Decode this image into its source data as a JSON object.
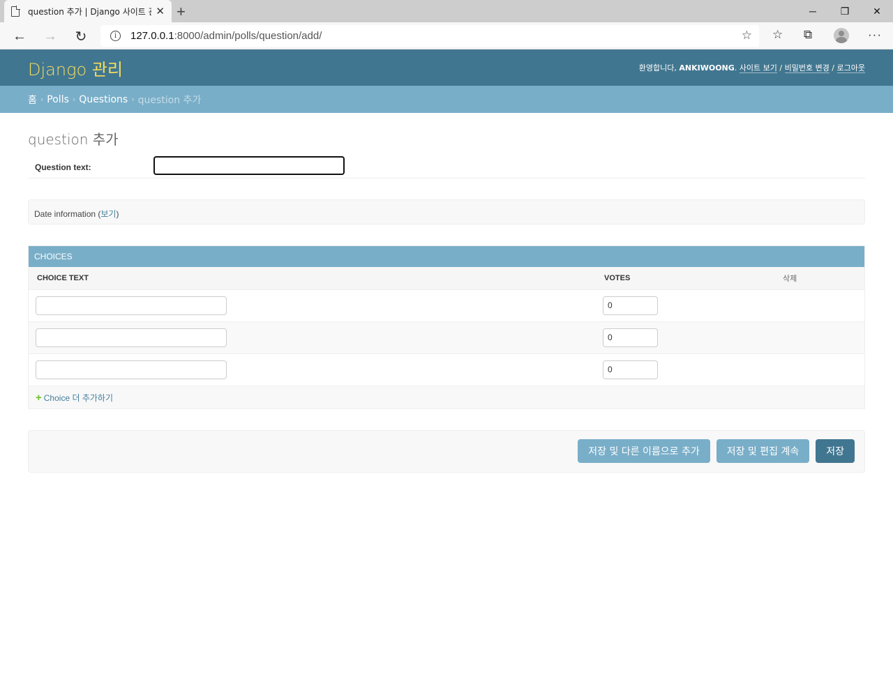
{
  "browser": {
    "tab_title": "question 추가 | Django 사이트 관",
    "url_host": "127.0.0.1",
    "url_path": ":8000/admin/polls/question/add/"
  },
  "header": {
    "branding": "Django 관리",
    "welcome": "환영합니다,",
    "username": "ANKIWOONG",
    "view_site": "사이트 보기",
    "change_password": "비밀번호 변경",
    "logout": "로그아웃"
  },
  "breadcrumbs": {
    "home": "홈",
    "app": "Polls",
    "model": "Questions",
    "current": "question 추가"
  },
  "page": {
    "title": "question 추가",
    "question_label": "Question text:",
    "date_fieldset": "Date information",
    "date_toggle": "보기"
  },
  "choices": {
    "heading": "Choices",
    "col_choice_text": "CHOICE TEXT",
    "col_votes": "VOTES",
    "col_delete": "삭제",
    "rows": [
      {
        "choice_text": "",
        "votes": "0"
      },
      {
        "choice_text": "",
        "votes": "0"
      },
      {
        "choice_text": "",
        "votes": "0"
      }
    ],
    "add_another": "Choice 더 추가하기"
  },
  "submit": {
    "save_add_another": "저장 및 다른 이름으로 추가",
    "save_continue": "저장 및 편집 계속",
    "save": "저장"
  }
}
